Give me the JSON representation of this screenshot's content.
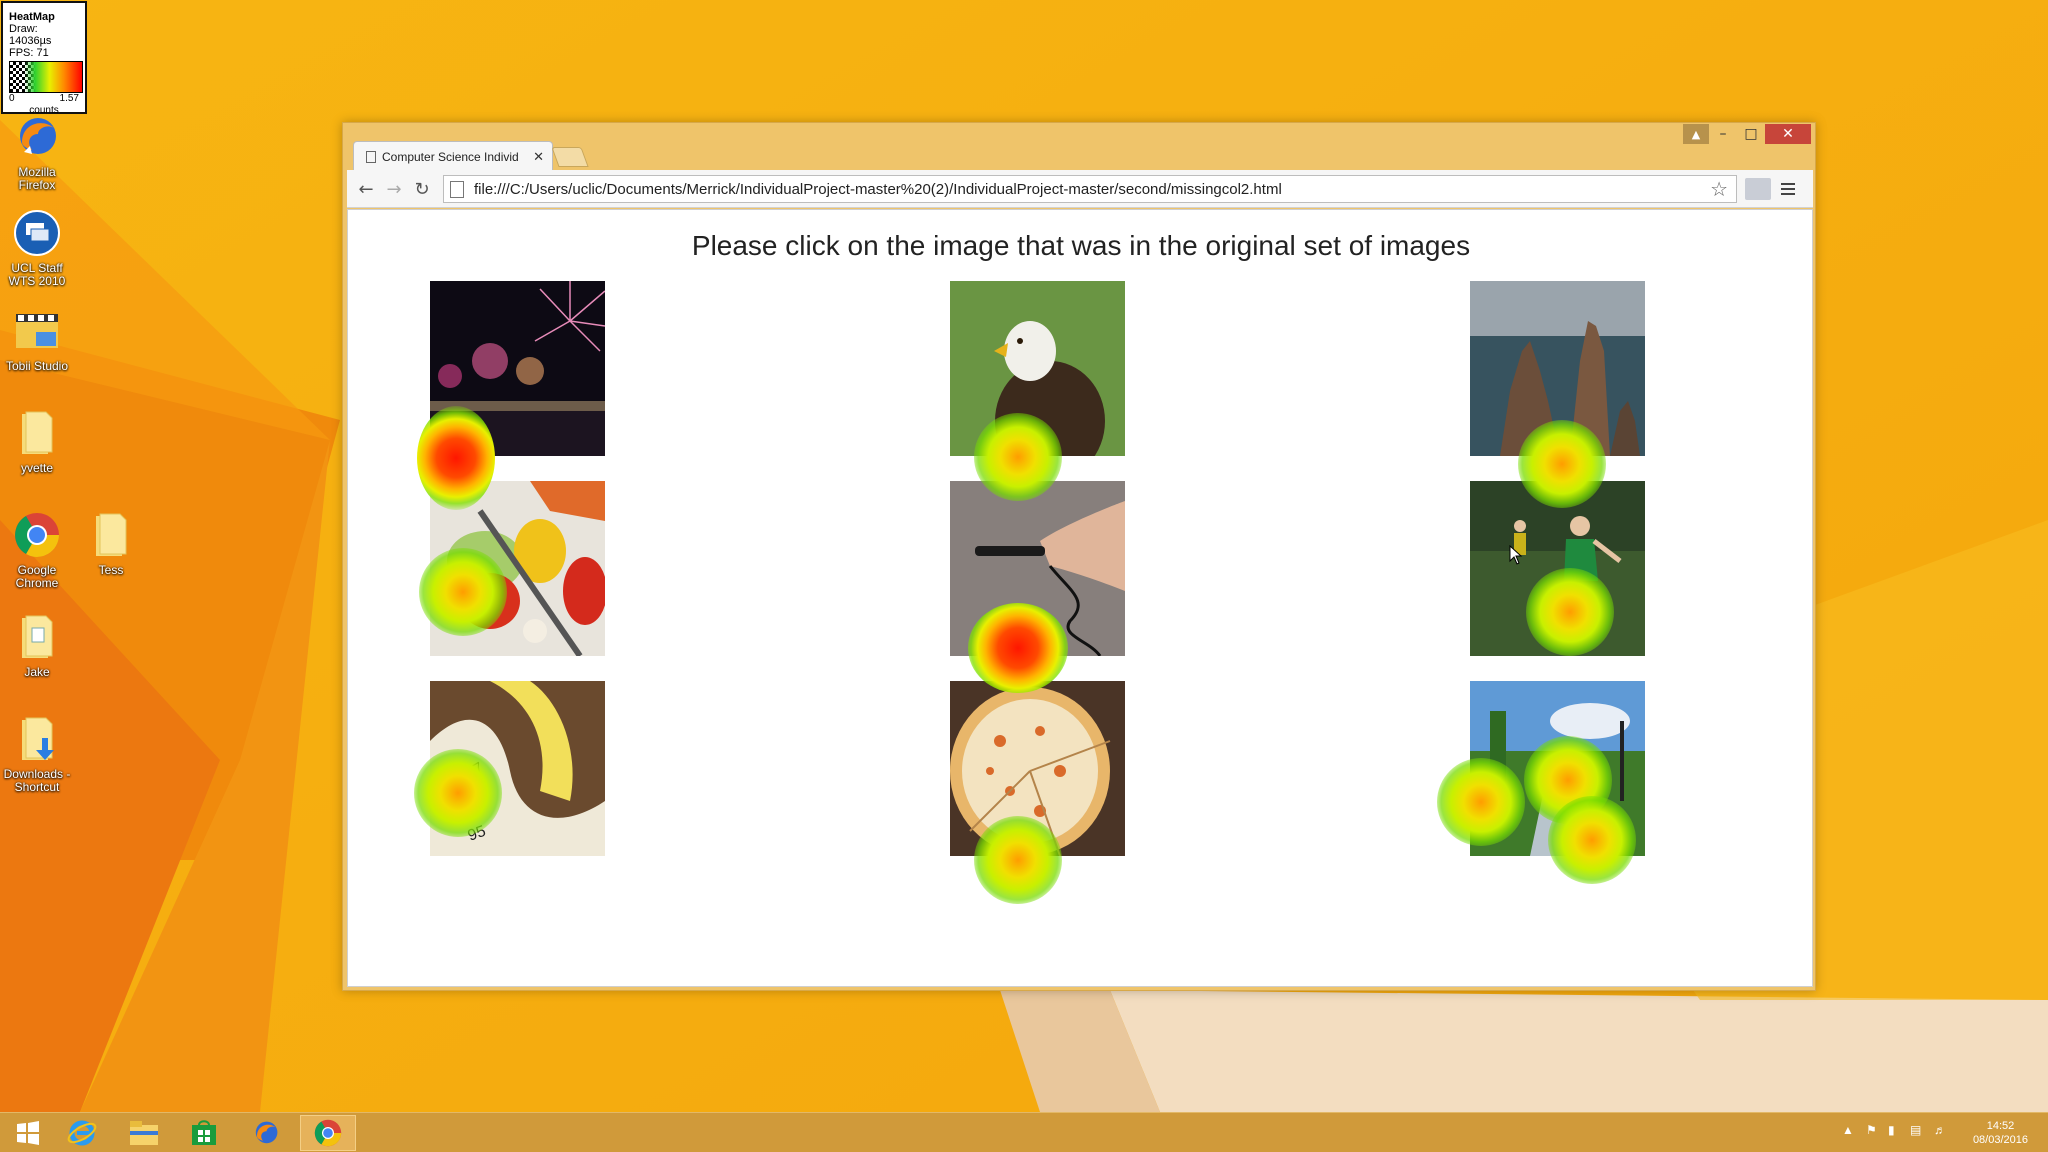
{
  "heatmap_legend": {
    "title": "HeatMap",
    "draw": "Draw: 14036µs",
    "fps": "FPS: 71",
    "min": "0",
    "max": "1.57",
    "unit": "counts"
  },
  "desktop_icons": [
    {
      "name": "firefox",
      "label": "Mozilla Firefox"
    },
    {
      "name": "ucl",
      "label": "UCL Staff WTS 2010"
    },
    {
      "name": "tobii",
      "label": "Tobii Studio"
    },
    {
      "name": "yvette",
      "label": "yvette"
    },
    {
      "name": "chrome",
      "label": "Google Chrome"
    },
    {
      "name": "tess",
      "label": "Tess"
    },
    {
      "name": "jake",
      "label": "Jake"
    },
    {
      "name": "downloads",
      "label": "Downloads - Shortcut"
    }
  ],
  "browser": {
    "tab_title": "Computer Science Individ",
    "url": "file:///C:/Users/uclic/Documents/Merrick/IndividualProject-master%20(2)/IndividualProject-master/second/missingcol2.html"
  },
  "page": {
    "heading": "Please click on the image that was in the original set of images"
  },
  "images": [
    {
      "subject": "fireworks"
    },
    {
      "subject": "eagle"
    },
    {
      "subject": "sea stacks"
    },
    {
      "subject": "vegetables"
    },
    {
      "subject": "hand with plug"
    },
    {
      "subject": "boy playing football"
    },
    {
      "subject": "tape measure"
    },
    {
      "subject": "pizza"
    },
    {
      "subject": "park path"
    }
  ],
  "heat_intensity": [
    {
      "image": "fireworks",
      "level": "high"
    },
    {
      "image": "eagle",
      "level": "low"
    },
    {
      "image": "sea stacks",
      "level": "low"
    },
    {
      "image": "vegetables",
      "level": "low"
    },
    {
      "image": "hand with plug",
      "level": "high"
    },
    {
      "image": "boy playing football",
      "level": "low"
    },
    {
      "image": "tape measure",
      "level": "low"
    },
    {
      "image": "pizza",
      "level": "low"
    },
    {
      "image": "park path",
      "level": "low"
    }
  ],
  "taskbar": {
    "items": [
      "start",
      "internet-explorer",
      "file-explorer",
      "store",
      "firefox",
      "chrome"
    ],
    "active": "chrome"
  },
  "clock": {
    "time": "14:52",
    "date": "08/03/2016"
  }
}
